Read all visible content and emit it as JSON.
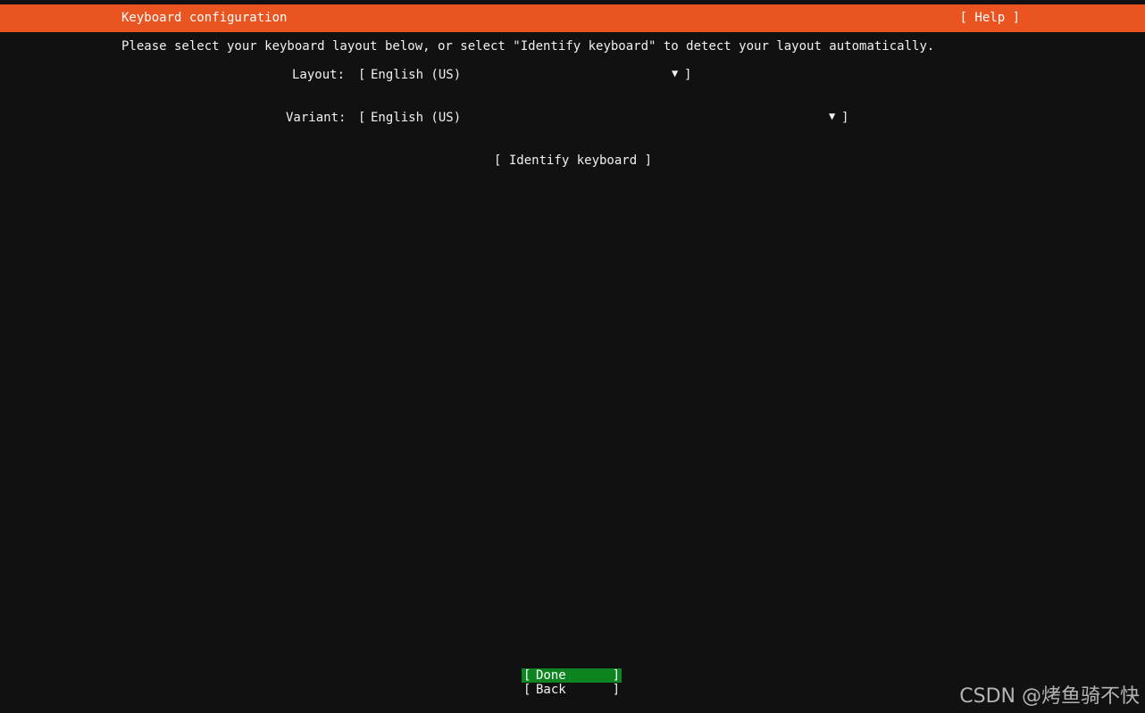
{
  "header": {
    "title": "Keyboard configuration",
    "help_label": "[ Help ]",
    "accent_color": "#e95420"
  },
  "instructions": "Please select your keyboard layout below, or select \"Identify keyboard\" to detect your layout automatically.",
  "layout": {
    "label": "Layout:",
    "value": "English (US)",
    "arrow_icon": "dropdown-arrow-icon"
  },
  "variant": {
    "label": "Variant:",
    "value": "English (US)",
    "arrow_icon": "dropdown-arrow-icon"
  },
  "identify_label": "[ Identify keyboard ]",
  "buttons": {
    "done_label": "Done",
    "back_label": "Back",
    "done_color": "#0e8420"
  },
  "watermark": "CSDN @烤鱼骑不快"
}
